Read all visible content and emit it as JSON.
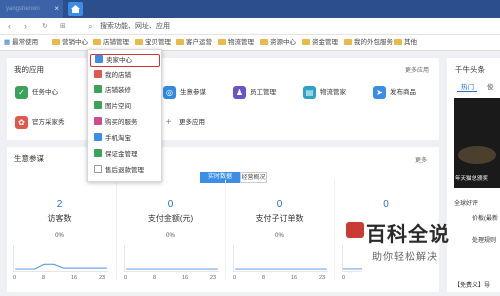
{
  "browser": {
    "tab_title": "yangshenxin",
    "tab_close": "×",
    "search_placeholder": "搜索功能、网址、应用"
  },
  "bookmarks": [
    "最常使用",
    "营销中心",
    "店铺管理",
    "宝贝管理",
    "客户运营",
    "物流管理",
    "资源中心",
    "资金管理",
    "我的外包服务",
    "其他"
  ],
  "my_apps": {
    "title": "我的应用",
    "more": "更多应用",
    "items": [
      {
        "label": "任务中心",
        "color": "#3aa35a",
        "glyph": "✓"
      },
      {
        "label": "生意参谋",
        "color": "#2f8be0",
        "glyph": "◎"
      },
      {
        "label": "员工管理",
        "color": "#6a55c7",
        "glyph": "♟"
      },
      {
        "label": "物流管家",
        "color": "#2aa3c7",
        "glyph": "▤"
      },
      {
        "label": "发布商品",
        "color": "#3a8ee6",
        "glyph": "➤"
      },
      {
        "label": "官方采家秀",
        "color": "#e0574b",
        "glyph": "✿"
      },
      {
        "label": "",
        "color": "#e07b39",
        "glyph": "▣"
      },
      {
        "label": "更多应用",
        "color": "#ffffff",
        "glyph": "+"
      }
    ]
  },
  "dropdown_menu": [
    {
      "label": "卖家中心",
      "color": "#3a8ee6"
    },
    {
      "label": "我的店铺",
      "color": "#e0574b"
    },
    {
      "label": "店铺装修",
      "color": "#3aa35a"
    },
    {
      "label": "图片空间",
      "color": "#3aa35a"
    },
    {
      "label": "购买的服务",
      "color": "#d04b8e"
    },
    {
      "label": "手机淘宝",
      "color": "#3a8ee6"
    },
    {
      "label": "保证金管理",
      "color": "#3aa35a"
    },
    {
      "label": "售后退款管理",
      "color": "#ffffff"
    }
  ],
  "business": {
    "title": "生意参谋",
    "more": "更多",
    "toggle": [
      "实时数据",
      "经营概况"
    ],
    "stats": [
      {
        "value": "2",
        "label": "访客数",
        "pct": "0%"
      },
      {
        "value": "0",
        "label": "支付金额(元)",
        "pct": "0%"
      },
      {
        "value": "0",
        "label": "支付子订单数",
        "pct": "0%"
      },
      {
        "value": "0",
        "label": "",
        "pct": ""
      }
    ],
    "axis_ticks": [
      "0",
      "8",
      "16",
      "23"
    ]
  },
  "right_panel": {
    "title": "千牛头条",
    "tab_hot": "热门",
    "tab_b": "俊",
    "items": [
      "全球好评",
      "价板(最新",
      "处理规则",
      "【免费"
    ],
    "news_footer": "【免费义】导",
    "image_caption": "年天猫总颁奖"
  },
  "watermark": {
    "big": "百科全说",
    "small": "助你轻松解决"
  },
  "colors": {
    "topbar": "#2b4f8c",
    "accent": "#2b6fc9",
    "highlight_border": "#d0342c"
  }
}
